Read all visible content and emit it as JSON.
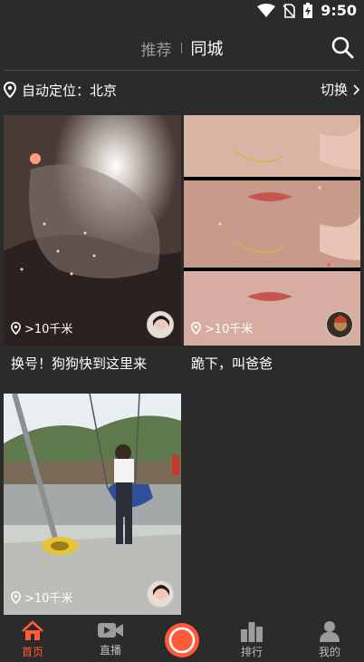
{
  "status_bar": {
    "time": "9:50"
  },
  "header": {
    "tabs": [
      {
        "label": "推荐",
        "active": false
      },
      {
        "label": "同城",
        "active": true
      }
    ]
  },
  "location": {
    "label": "自动定位：北京",
    "switch_label": "切换"
  },
  "feed": [
    {
      "distance": ">10千米",
      "title": "换号！狗狗快到这里来"
    },
    {
      "distance": ">10千米",
      "title": "跪下，叫爸爸"
    },
    {
      "distance": ">10千米",
      "title": ""
    }
  ],
  "bottom_nav": [
    {
      "label": "首页",
      "icon": "home-icon",
      "active": true
    },
    {
      "label": "直播",
      "icon": "video-camera-icon",
      "active": false
    },
    {
      "label": "",
      "icon": "record-icon",
      "active": false
    },
    {
      "label": "排行",
      "icon": "bar-chart-icon",
      "active": false
    },
    {
      "label": "我的",
      "icon": "person-icon",
      "active": false
    }
  ],
  "colors": {
    "background": "#2b2b2b",
    "accent": "#ff5a3a",
    "inactive_tab": "#9a9a9a"
  }
}
